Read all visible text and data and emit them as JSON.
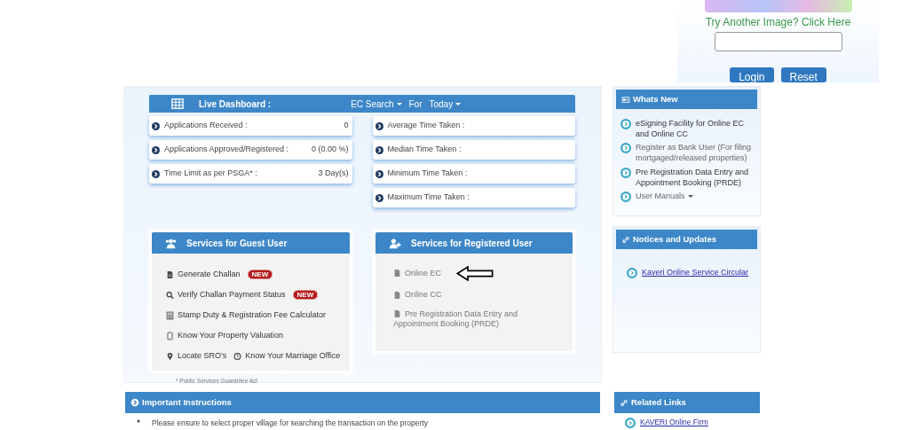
{
  "login": {
    "captcha_link": "Try Another Image? Click Here",
    "buttons": [
      "Login",
      "Reset"
    ]
  },
  "dashboard": {
    "title": "Live Dashboard :",
    "search_type": "EC Search",
    "for_label": "For",
    "period": "Today",
    "stats_left": [
      {
        "label": "Applications Received :",
        "value": "0"
      },
      {
        "label": "Applications Approved/Registered :",
        "value": "0 (0.00 %)"
      },
      {
        "label": "Time Limit as per PSGA* :",
        "value": "3 Day(s)"
      }
    ],
    "stats_right": [
      {
        "label": "Average Time Taken :"
      },
      {
        "label": "Median Time Taken :"
      },
      {
        "label": "Minimum Time Taken :"
      },
      {
        "label": "Maximum Time Taken :"
      }
    ]
  },
  "guest_services": {
    "title": "Services for Guest User",
    "rows": [
      [
        {
          "label": "Generate Challan",
          "kind": "file",
          "badge": "NEW"
        }
      ],
      [
        {
          "label": "Verify Challan Payment Status",
          "kind": "search",
          "badge": "NEW"
        }
      ],
      [
        {
          "label": "Stamp Duty & Registration Fee Calculator",
          "kind": "calculator"
        }
      ],
      [
        {
          "label": "Know Your Property Valuation",
          "kind": "mobile"
        }
      ],
      [
        {
          "label": "Locate SRO's",
          "kind": "pin"
        },
        {
          "label": "Know Your Marriage Office",
          "kind": "clock"
        }
      ]
    ]
  },
  "registered_services": {
    "title": "Services for Registered User",
    "items": [
      {
        "label": "Online EC",
        "pointed": true
      },
      {
        "label": "Online CC",
        "pointed": false
      },
      {
        "label": "Pre Registration Data Entry and Appointment Booking (PRDE)",
        "pointed": false
      }
    ]
  },
  "footnote": "* Public Services Guarantee Act",
  "whats_new": {
    "title": "Whats New",
    "items": [
      {
        "label": "eSigning Facility for Online EC and Online CC",
        "dropdown": false
      },
      {
        "label": "Register as Bank User (For filing mortgaged/released properties)",
        "dropdown": false
      },
      {
        "label": "Pre Registration Data Entry and Appointment Booking (PRDE)",
        "dropdown": false
      },
      {
        "label": "User Manuals",
        "dropdown": true
      }
    ]
  },
  "notices": {
    "title": "Notices and Updates",
    "items": [
      "Kaveri Online Service Circular"
    ]
  },
  "instructions": {
    "title": "Important Instructions",
    "items": [
      "Please ensure to select proper village for searching the transaction on the property"
    ]
  },
  "related_links": {
    "title": "Related Links",
    "items": [
      "KAVERI Online Firm"
    ]
  }
}
